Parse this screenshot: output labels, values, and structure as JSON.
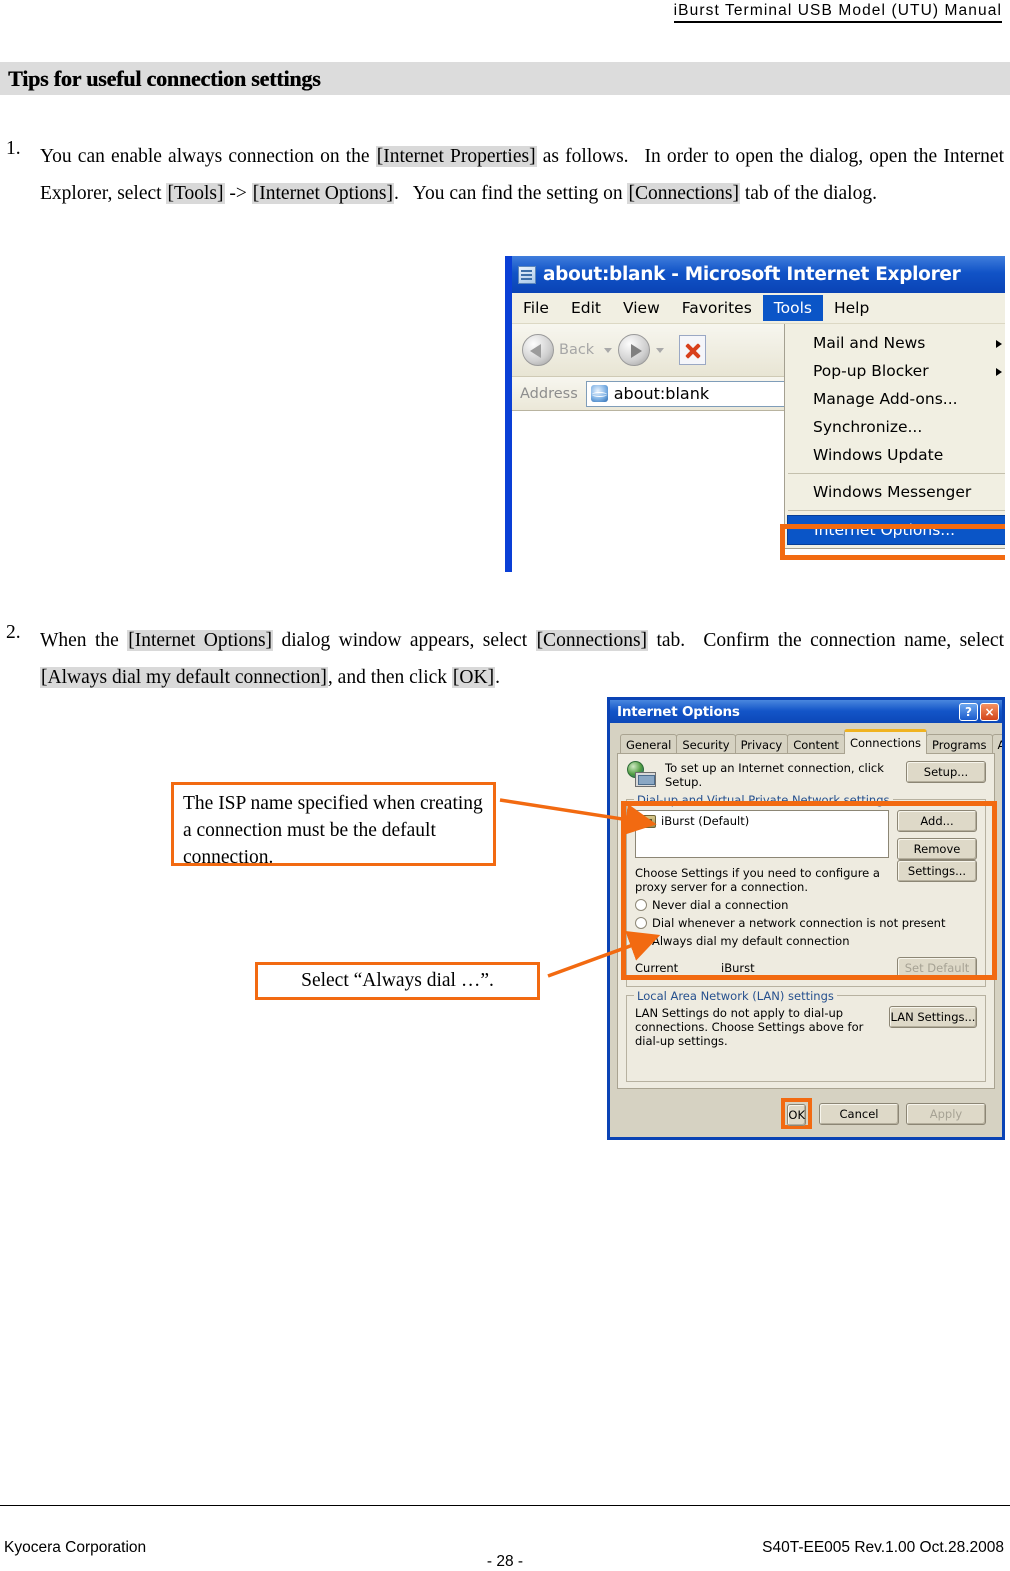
{
  "document": {
    "running_header": "iBurst Terminal USB Model (UTU) Manual",
    "section_title": "Tips for useful connection settings"
  },
  "steps": [
    {
      "number": "1.",
      "segments": [
        {
          "text": "You can enable always connection on the ",
          "highlight": false
        },
        {
          "text": "[Internet Properties]",
          "highlight": true
        },
        {
          "text": " as follows.  In order to open the dialog, open the Internet Explorer, select ",
          "highlight": false
        },
        {
          "text": "[Tools]",
          "highlight": true
        },
        {
          "text": " -> ",
          "highlight": false
        },
        {
          "text": "[Internet Options]",
          "highlight": true
        },
        {
          "text": ".  You can find the setting on ",
          "highlight": false
        },
        {
          "text": "[Connections]",
          "highlight": true
        },
        {
          "text": " tab of the dialog.",
          "highlight": false
        }
      ]
    },
    {
      "number": "2.",
      "segments": [
        {
          "text": "When the ",
          "highlight": false
        },
        {
          "text": "[Internet Options]",
          "highlight": true
        },
        {
          "text": " dialog window appears, select ",
          "highlight": false
        },
        {
          "text": "[Connections]",
          "highlight": true
        },
        {
          "text": " tab.  Confirm the connection name, select ",
          "highlight": false
        },
        {
          "text": "[Always dial my default connection]",
          "highlight": true
        },
        {
          "text": ", and then click ",
          "highlight": false
        },
        {
          "text": "[OK]",
          "highlight": true
        },
        {
          "text": ".",
          "highlight": false
        }
      ]
    }
  ],
  "ie_window": {
    "title": "about:blank - Microsoft Internet Explorer",
    "title_icon": "page-icon",
    "menus": [
      {
        "label": "File",
        "active": false
      },
      {
        "label": "Edit",
        "active": false
      },
      {
        "label": "View",
        "active": false
      },
      {
        "label": "Favorites",
        "active": false
      },
      {
        "label": "Tools",
        "active": true
      },
      {
        "label": "Help",
        "active": false
      }
    ],
    "toolbar": {
      "back_label": "Back",
      "back_icon": "arrow-left-icon",
      "forward_icon": "arrow-right-icon",
      "stop_icon": "stop-x-icon"
    },
    "address_bar": {
      "label": "Address",
      "value": "about:blank",
      "icon": "ie-e-icon"
    },
    "tools_menu": {
      "items": [
        {
          "label": "Mail and News",
          "submenu": true,
          "separator_after": false,
          "selected": false
        },
        {
          "label": "Pop-up Blocker",
          "submenu": true,
          "separator_after": false,
          "selected": false
        },
        {
          "label": "Manage Add-ons...",
          "submenu": false,
          "separator_after": false,
          "selected": false
        },
        {
          "label": "Synchronize...",
          "submenu": false,
          "separator_after": false,
          "selected": false
        },
        {
          "label": "Windows Update",
          "submenu": false,
          "separator_after": true,
          "selected": false
        },
        {
          "label": "Windows Messenger",
          "submenu": false,
          "separator_after": true,
          "selected": false
        },
        {
          "label": "Internet Options...",
          "submenu": false,
          "separator_after": false,
          "selected": true
        }
      ]
    }
  },
  "internet_options_dialog": {
    "title": "Internet Options",
    "help_button": "?",
    "close_button": "×",
    "tabs": [
      {
        "label": "General",
        "active": false
      },
      {
        "label": "Security",
        "active": false
      },
      {
        "label": "Privacy",
        "active": false
      },
      {
        "label": "Content",
        "active": false
      },
      {
        "label": "Connections",
        "active": true
      },
      {
        "label": "Programs",
        "active": false
      },
      {
        "label": "Advanced",
        "active": false
      }
    ],
    "setup_section": {
      "icon": "globe-computer-icon",
      "text": "To set up an Internet connection, click Setup.",
      "button": "Setup..."
    },
    "dialup_group": {
      "legend": "Dial-up and Virtual Private Network settings",
      "connection_entry": {
        "icon": "modem-icon",
        "label": "iBurst (Default)"
      },
      "buttons": [
        {
          "label": "Add...",
          "disabled": false
        },
        {
          "label": "Remove",
          "disabled": false
        },
        {
          "label": "Settings...",
          "disabled": false
        }
      ],
      "proxy_note": "Choose Settings if you need to configure a proxy server for a connection.",
      "radio_options": [
        {
          "label": "Never dial a connection",
          "selected": false
        },
        {
          "label": "Dial whenever a network connection is not present",
          "selected": false
        },
        {
          "label": "Always dial my default connection",
          "selected": true
        }
      ],
      "current_label": "Current",
      "current_value": "iBurst",
      "set_default_button": {
        "label": "Set Default",
        "disabled": true
      }
    },
    "lan_group": {
      "legend": "Local Area Network (LAN) settings",
      "note": "LAN Settings do not apply to dial-up connections. Choose Settings above for dial-up settings.",
      "button": "LAN Settings..."
    },
    "footer_buttons": [
      {
        "label": "OK",
        "disabled": false,
        "highlighted": true
      },
      {
        "label": "Cancel",
        "disabled": false,
        "highlighted": false
      },
      {
        "label": "Apply",
        "disabled": true,
        "highlighted": false
      }
    ]
  },
  "annotations": [
    {
      "id": "isp-name-note",
      "text": "The ISP name specified when creating a connection must be the default connection."
    },
    {
      "id": "select-always-dial-note",
      "text": "Select “Always dial …”."
    }
  ],
  "colors": {
    "highlight_orange": "#f26a11",
    "text_highlight_gray": "#d9d9d9",
    "band_gray": "#dcdcdc",
    "title_blue": "#0a43b5",
    "selection_blue": "#0a55c7",
    "tab_accent": "#f0b320"
  },
  "footer": {
    "left": "Kyocera Corporation",
    "center": "- 28 -",
    "right": "S40T-EE005 Rev.1.00 Oct.28.2008"
  }
}
